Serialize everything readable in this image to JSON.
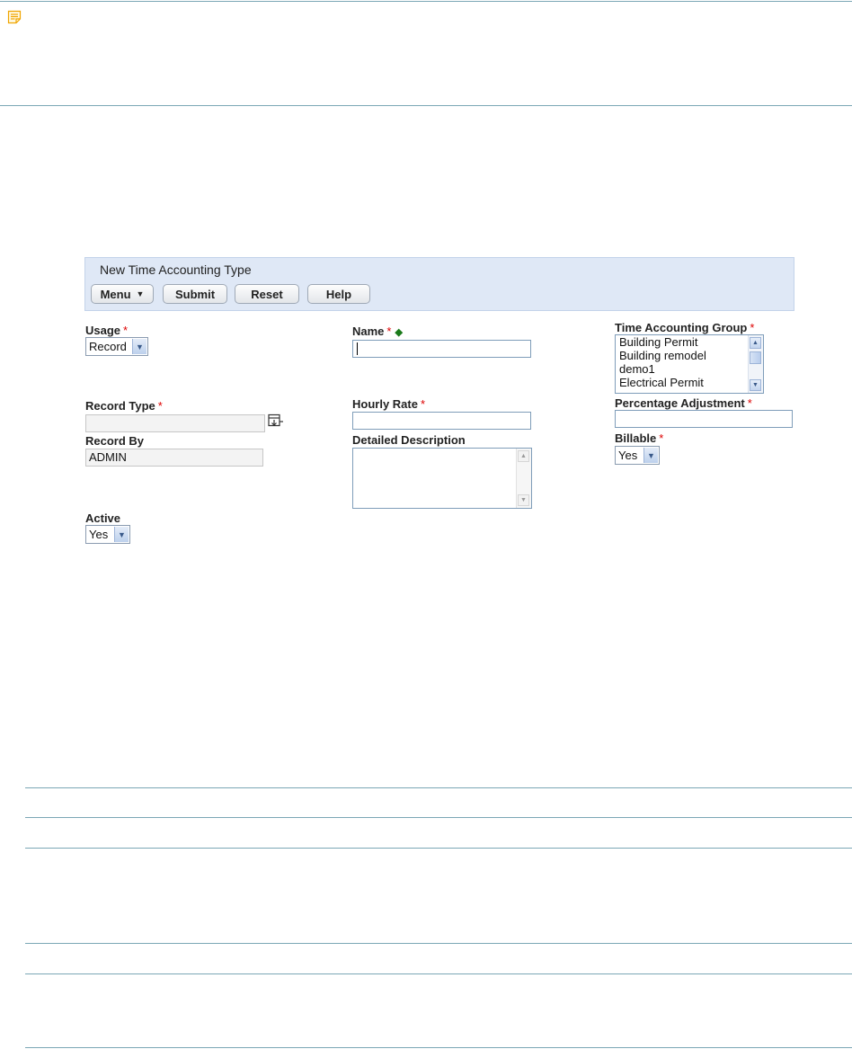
{
  "panel": {
    "title": "New Time Accounting Type",
    "buttons": {
      "menu": "Menu",
      "submit": "Submit",
      "reset": "Reset",
      "help": "Help"
    }
  },
  "required_marker": "*",
  "fields": {
    "usage": {
      "label": "Usage",
      "value": "Record"
    },
    "name": {
      "label": "Name",
      "value": ""
    },
    "time_accounting_group": {
      "label": "Time Accounting Group",
      "options": [
        "Building Permit",
        "Building remodel",
        "demo1",
        "Electrical Permit"
      ]
    },
    "record_type": {
      "label": "Record Type",
      "value": ""
    },
    "hourly_rate": {
      "label": "Hourly Rate",
      "value": ""
    },
    "percentage_adjustment": {
      "label": "Percentage Adjustment",
      "value": ""
    },
    "record_by": {
      "label": "Record By",
      "value": "ADMIN"
    },
    "detailed_description": {
      "label": "Detailed Description",
      "value": ""
    },
    "billable": {
      "label": "Billable",
      "value": "Yes"
    },
    "active": {
      "label": "Active",
      "value": "Yes"
    }
  },
  "icons": {
    "note": "note-icon",
    "dropdown": "chevron-down-icon",
    "record_type_picker": "select-record-type-icon",
    "key_field": "diamond-icon"
  },
  "colors": {
    "panel_background": "#dfe8f6",
    "required": "#dd0000",
    "rule_lines": "#7ba7b5",
    "note_icon": "#f0a500"
  }
}
